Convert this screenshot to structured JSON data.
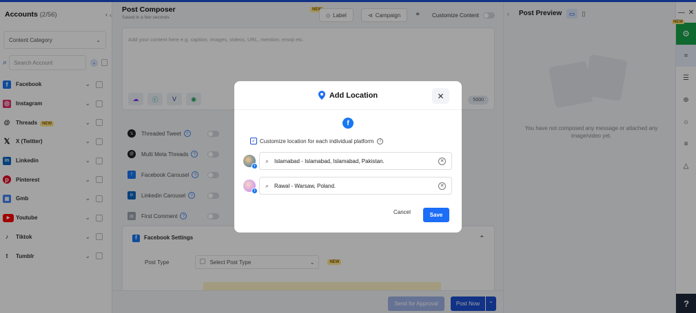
{
  "accounts": {
    "title": "Accounts",
    "count": "(2/56)",
    "category_placeholder": "Content Category",
    "search_placeholder": "Search Account",
    "platforms": [
      {
        "label": "Facebook",
        "badge": ""
      },
      {
        "label": "Instagram",
        "badge": ""
      },
      {
        "label": "Threads",
        "badge": "NEW"
      },
      {
        "label": "X (Twitter)",
        "badge": ""
      },
      {
        "label": "Linkedin",
        "badge": ""
      },
      {
        "label": "Pinterest",
        "badge": ""
      },
      {
        "label": "Gmb",
        "badge": ""
      },
      {
        "label": "Youtube",
        "badge": ""
      },
      {
        "label": "Tiktok",
        "badge": ""
      },
      {
        "label": "Tumblr",
        "badge": ""
      }
    ]
  },
  "composer": {
    "title": "Post Composer",
    "subtitle": "Saved in a few seconds",
    "new_badge": "NEW",
    "label_btn": "Label",
    "campaign_btn": "Campaign",
    "customize_content": "Customize Content",
    "editor_placeholder": "Add your content here e.g. caption, images, videos, URL, mention, emoji etc.",
    "char_count": "5000",
    "options": [
      {
        "label": "Threaded Tweet"
      },
      {
        "label": "Multi Meta Threads"
      },
      {
        "label": "Facebook Carousel"
      },
      {
        "label": "Linkedin Carousel"
      },
      {
        "label": "First Comment"
      }
    ],
    "facebook_settings": "Facebook Settings",
    "post_type_label": "Post Type",
    "post_type_placeholder": "Select Post Type",
    "post_type_badge": "NEW",
    "send_for_approval": "Send for Approval",
    "post_now": "Post Now"
  },
  "preview": {
    "title": "Post Preview",
    "empty_message": "You have not composed any message or attached any image/video yet."
  },
  "rail": {
    "new_badge": "NEW",
    "help": "?"
  },
  "modal": {
    "title": "Add Location",
    "customize_label": "Customize location for each individual platform",
    "locations": [
      {
        "value": "Islamabad - Islamabad, Islamabad, Pakistan."
      },
      {
        "value": "Rawal - Warsaw, Poland."
      }
    ],
    "cancel": "Cancel",
    "save": "Save"
  },
  "colors": {
    "accent": "#1c4fd0",
    "facebook": "#1877f2",
    "save_button": "#1c6df7"
  }
}
